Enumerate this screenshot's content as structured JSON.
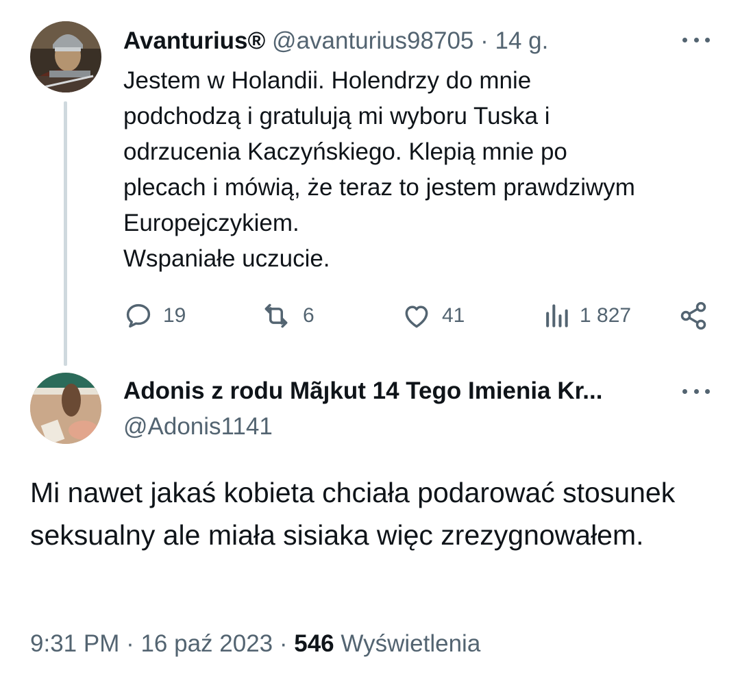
{
  "parent_tweet": {
    "author_name": "Avanturius®",
    "author_handle": "@avanturius98705",
    "separator": "·",
    "time_ago": "14 g.",
    "text": "Jestem w Holandii. Holendrzy do mnie\npodchodzą i gratulują mi wyboru Tuska i\nodrzucenia Kaczyńskiego. Klepią mnie po\nplecach i mówią, że teraz to jestem prawdziwym\nEuropejczykiem.\nWspaniałe uczucie.",
    "actions": {
      "replies": "19",
      "reposts": "6",
      "likes": "41",
      "views": "1 827"
    },
    "icons": {
      "reply": "reply-icon",
      "repost": "repost-icon",
      "like": "heart-icon",
      "views": "views-icon",
      "share": "share-icon",
      "more": "more-icon"
    }
  },
  "reply_tweet": {
    "author_name": "Adonis z rodu Mãȷkut 14 Tego Imienia Kr...",
    "author_handle": "@Adonis1141",
    "text": "Mi nawet jakaś kobieta chciała podarować stosunek seksualny ale miała sisiaka więc zrezygnowałem.",
    "timestamp": "9:31 PM · 16 paź 2023 ·",
    "views_count": "546",
    "views_label": "Wyświetlenia"
  },
  "colors": {
    "text_primary": "#0f1419",
    "text_secondary": "#536471",
    "thread_line": "#cfd9de"
  }
}
